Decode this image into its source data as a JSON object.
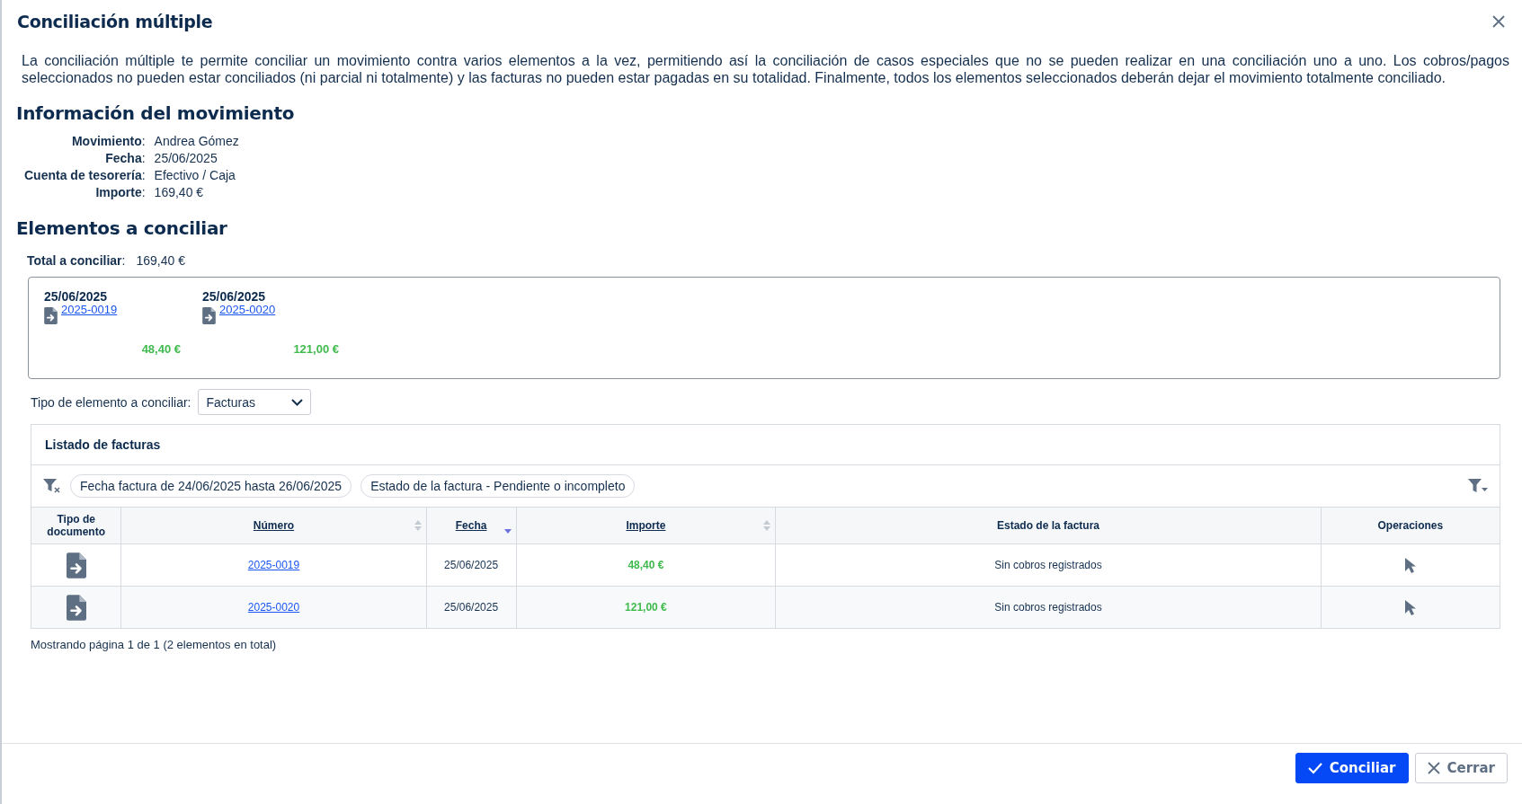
{
  "dialog": {
    "title": "Conciliación múltiple",
    "description": "La conciliación múltiple te permite conciliar un movimiento contra varios elementos a la vez, permitiendo así la conciliación de casos especiales que no se pueden realizar en una conciliación uno a uno. Los cobros/pagos seleccionados no pueden estar conciliados (ni parcial ni totalmente) y las facturas no pueden estar pagadas en su totalidad. Finalmente, todos los elementos seleccionados deberán dejar el movimiento totalmente conciliado."
  },
  "movement": {
    "heading": "Información del movimiento",
    "fields": [
      {
        "label": "**Movimiento**:",
        "value": "Andrea Gómez"
      },
      {
        "label": "**Fecha**:",
        "value": "25/06/2025"
      },
      {
        "label": "**Cuenta de tesorería**:",
        "value": "Efectivo / Caja"
      },
      {
        "label": "**Importe**:",
        "value": "169,40 €"
      }
    ]
  },
  "elements": {
    "heading": "Elementos a conciliar",
    "total_label": "**Total a conciliar**:",
    "total_value": "169,40 €",
    "selected": [
      {
        "date": "25/06/2025",
        "number": "2025-0019",
        "amount": "48,40 €"
      },
      {
        "date": "25/06/2025",
        "number": "2025-0020",
        "amount": "121,00 €"
      }
    ],
    "type_label": "Tipo de elemento a conciliar:",
    "type_value": "Facturas"
  },
  "invoice_list": {
    "title": "Listado de facturas",
    "filters": [
      "Fecha factura de 24/06/2025 hasta 26/06/2025",
      "Estado de la factura - Pendiente o incompleto"
    ],
    "columns": [
      {
        "label": "Tipo de documento",
        "sortable": false,
        "sorted_descending": false
      },
      {
        "label": "Número",
        "sortable": true,
        "sorted_descending": false
      },
      {
        "label": "Fecha",
        "sortable": true,
        "sorted_descending": true
      },
      {
        "label": "Importe",
        "sortable": true,
        "sorted_descending": false
      },
      {
        "label": "Estado de la factura",
        "sortable": false,
        "sorted_descending": false
      },
      {
        "label": "Operaciones",
        "sortable": false,
        "sorted_descending": false
      }
    ],
    "rows": [
      {
        "number": "2025-0019",
        "date": "25/06/2025",
        "amount": "48,40 €",
        "status": "Sin cobros registrados"
      },
      {
        "number": "2025-0020",
        "date": "25/06/2025",
        "amount": "121,00 €",
        "status": "Sin cobros registrados"
      }
    ],
    "pagination": "Mostrando página 1 de 1 (2 elementos en total)"
  },
  "buttons": [
    {
      "label": "Conciliar",
      "kind": "primary"
    },
    {
      "label": "Cerrar",
      "kind": "secondary"
    }
  ]
}
